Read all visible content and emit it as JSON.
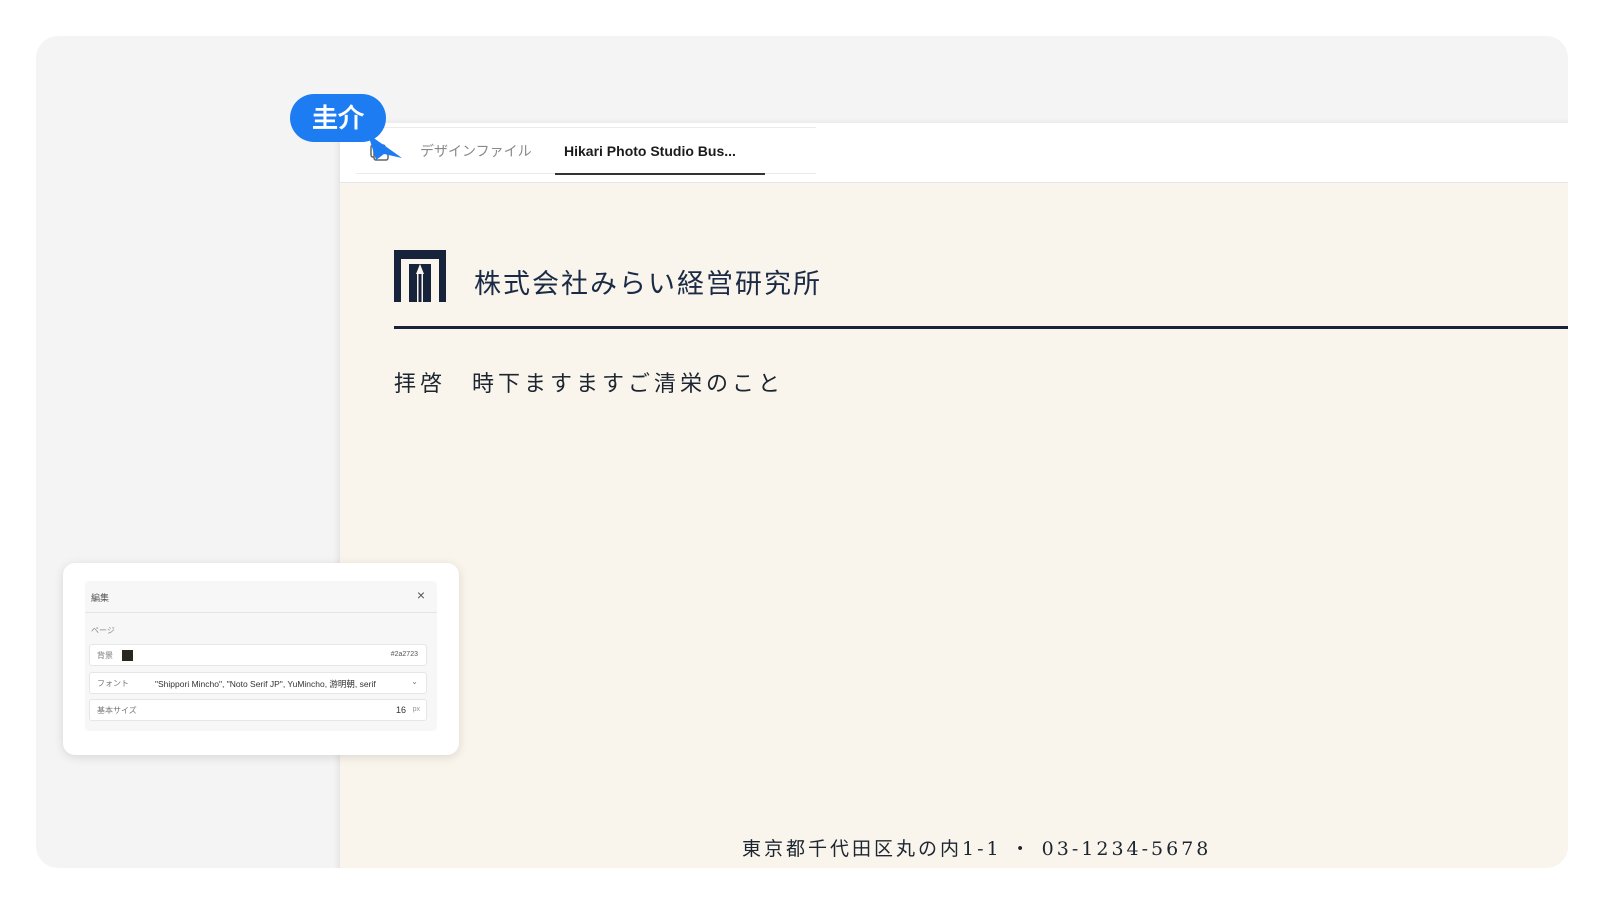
{
  "tabs": {
    "design_files_label": "デザインファイル",
    "active_label": "Hikari Photo Studio Bus..."
  },
  "document": {
    "company_name": "株式会社みらい経営研究所",
    "greeting": "拝啓　時下ますますご清栄のこと",
    "address_line": "東京都千代田区丸の内1-1 ・ 03-1234-5678",
    "brand_color": "#16233b",
    "paper_color": "#f9f5ec"
  },
  "collaborator": {
    "name": "圭介",
    "color": "#1d7cf2"
  },
  "edit_panel": {
    "title": "編集",
    "close_label": "×",
    "section_label": "ページ",
    "background_label": "背景",
    "background_value": "#2a2723",
    "font_label": "フォント",
    "font_value": "\"Shippori Mincho\", \"Noto Serif JP\", YuMincho, 游明朝, serif",
    "base_size_label": "基本サイズ",
    "base_size_value": "16",
    "base_size_unit": "px"
  },
  "icons": {
    "tab_icon": "file-stack-icon",
    "cursor": "pointer-arrow-icon",
    "logo": "company-logo-icon",
    "close": "close-icon",
    "dropdown": "chevron-down-icon"
  }
}
